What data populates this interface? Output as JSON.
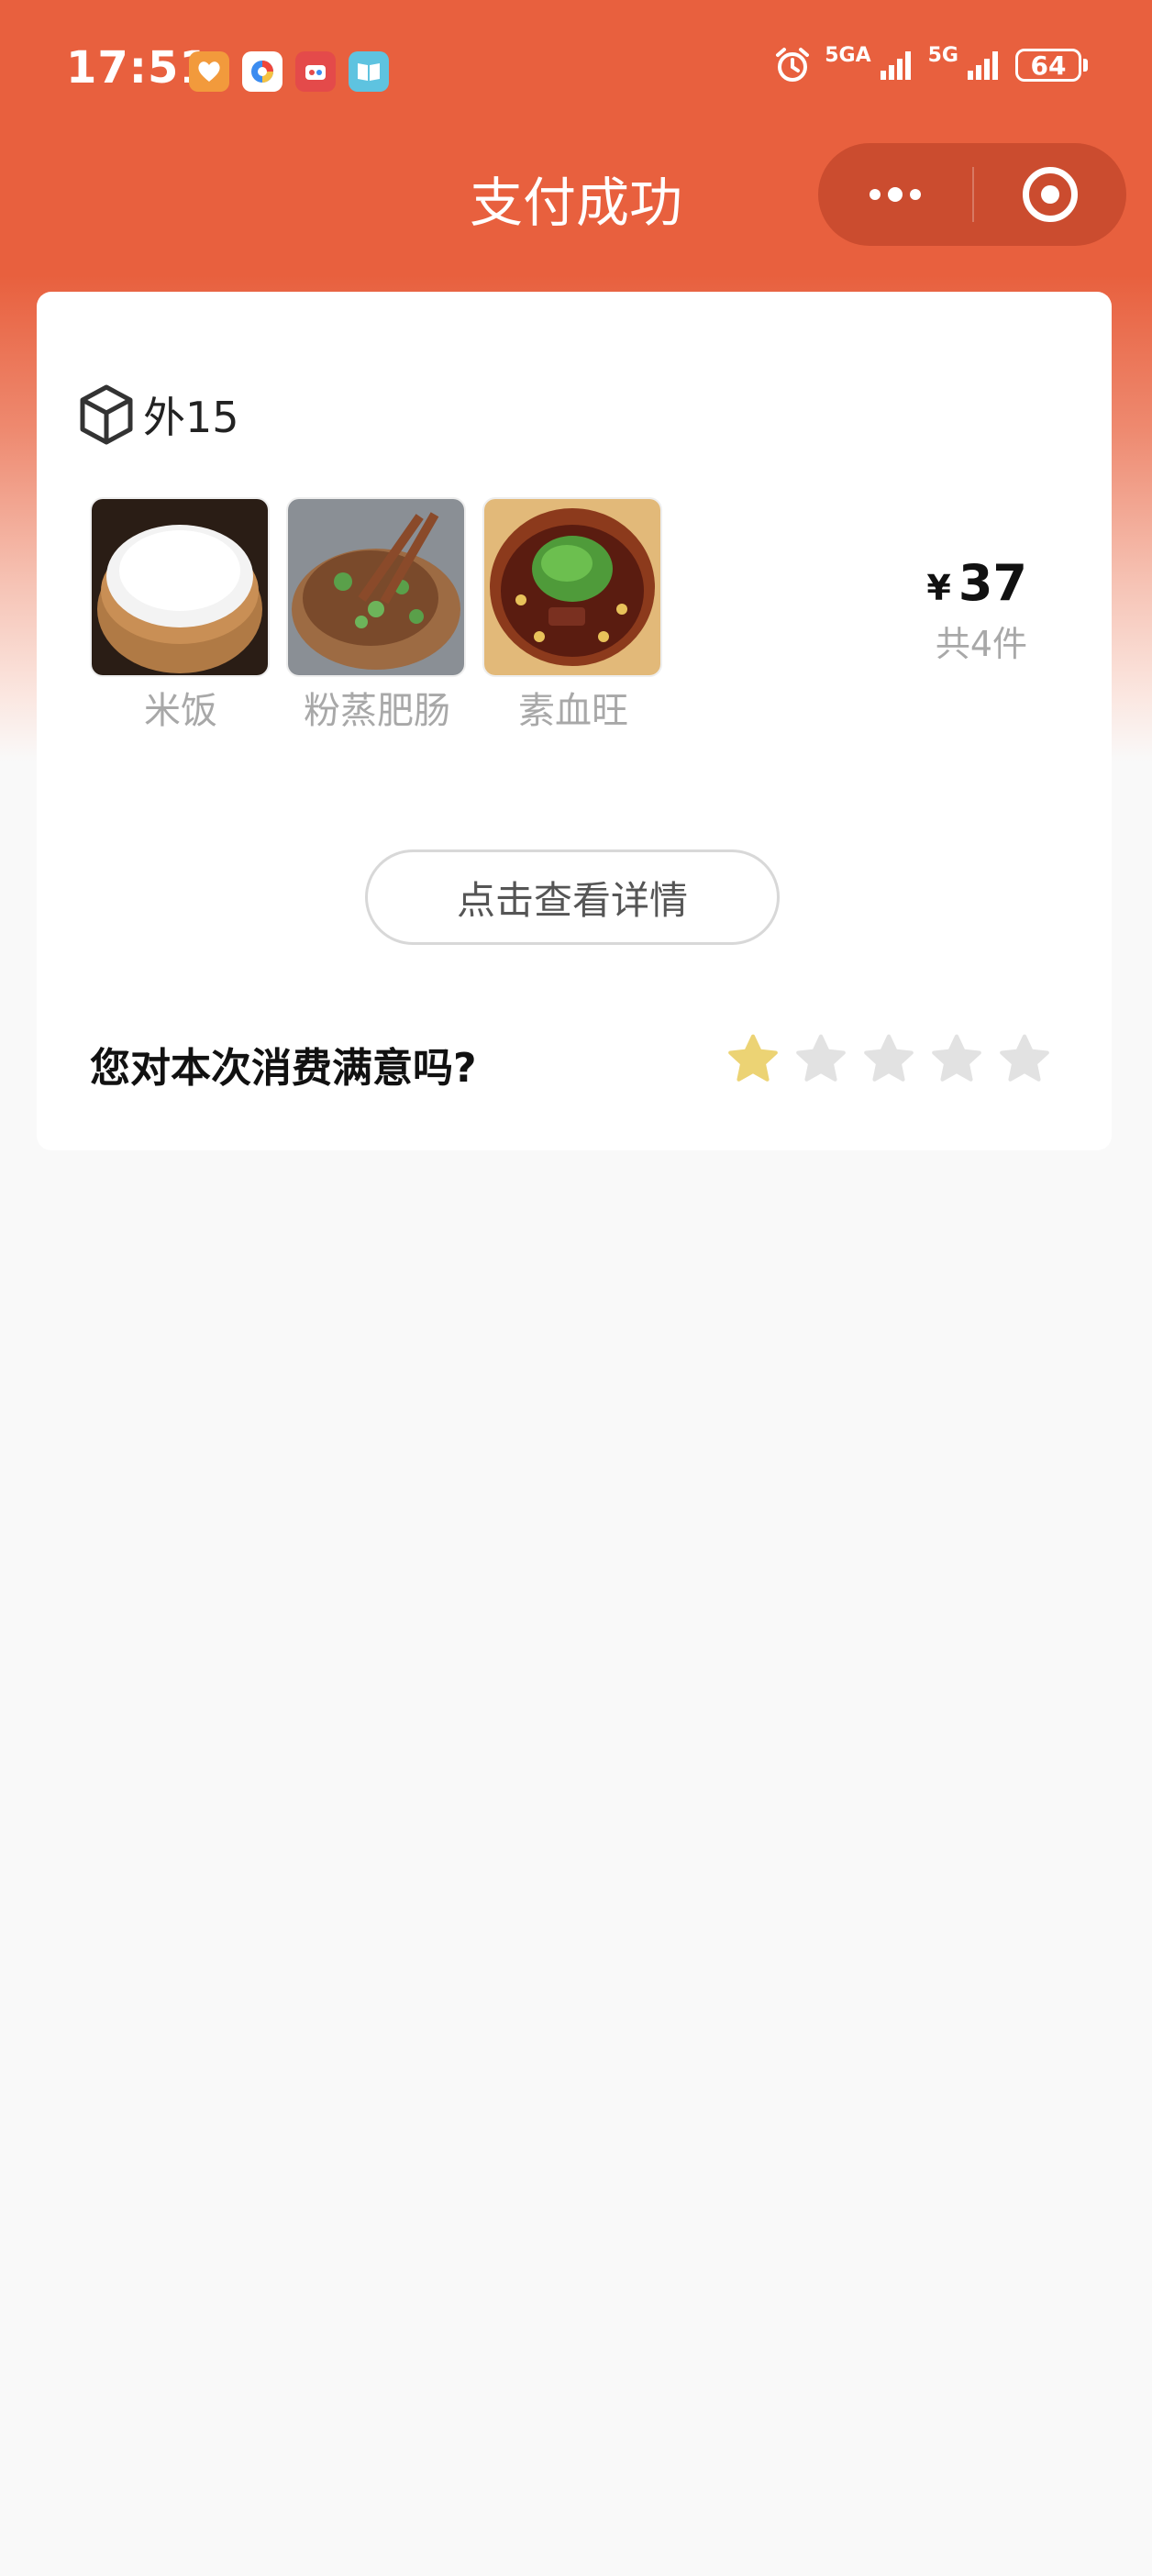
{
  "status_bar": {
    "time": "17:51",
    "signal_1_label": "5GA",
    "signal_2_label": "5G",
    "battery": "64"
  },
  "nav": {
    "title": "支付成功"
  },
  "order": {
    "number": "外15",
    "dishes": [
      {
        "name": "米饭"
      },
      {
        "name": "粉蒸肥肠"
      },
      {
        "name": "素血旺"
      }
    ],
    "currency_symbol": "¥",
    "total_price": "37",
    "item_count": "共4件"
  },
  "detail_button": {
    "label": "点击查看详情"
  },
  "rating": {
    "question": "您对本次消费满意吗?",
    "value": 1,
    "max": 5,
    "active_color": "#ecd374",
    "inactive_color": "#e2e2e2"
  },
  "colors": {
    "brand": "#e8603e"
  }
}
